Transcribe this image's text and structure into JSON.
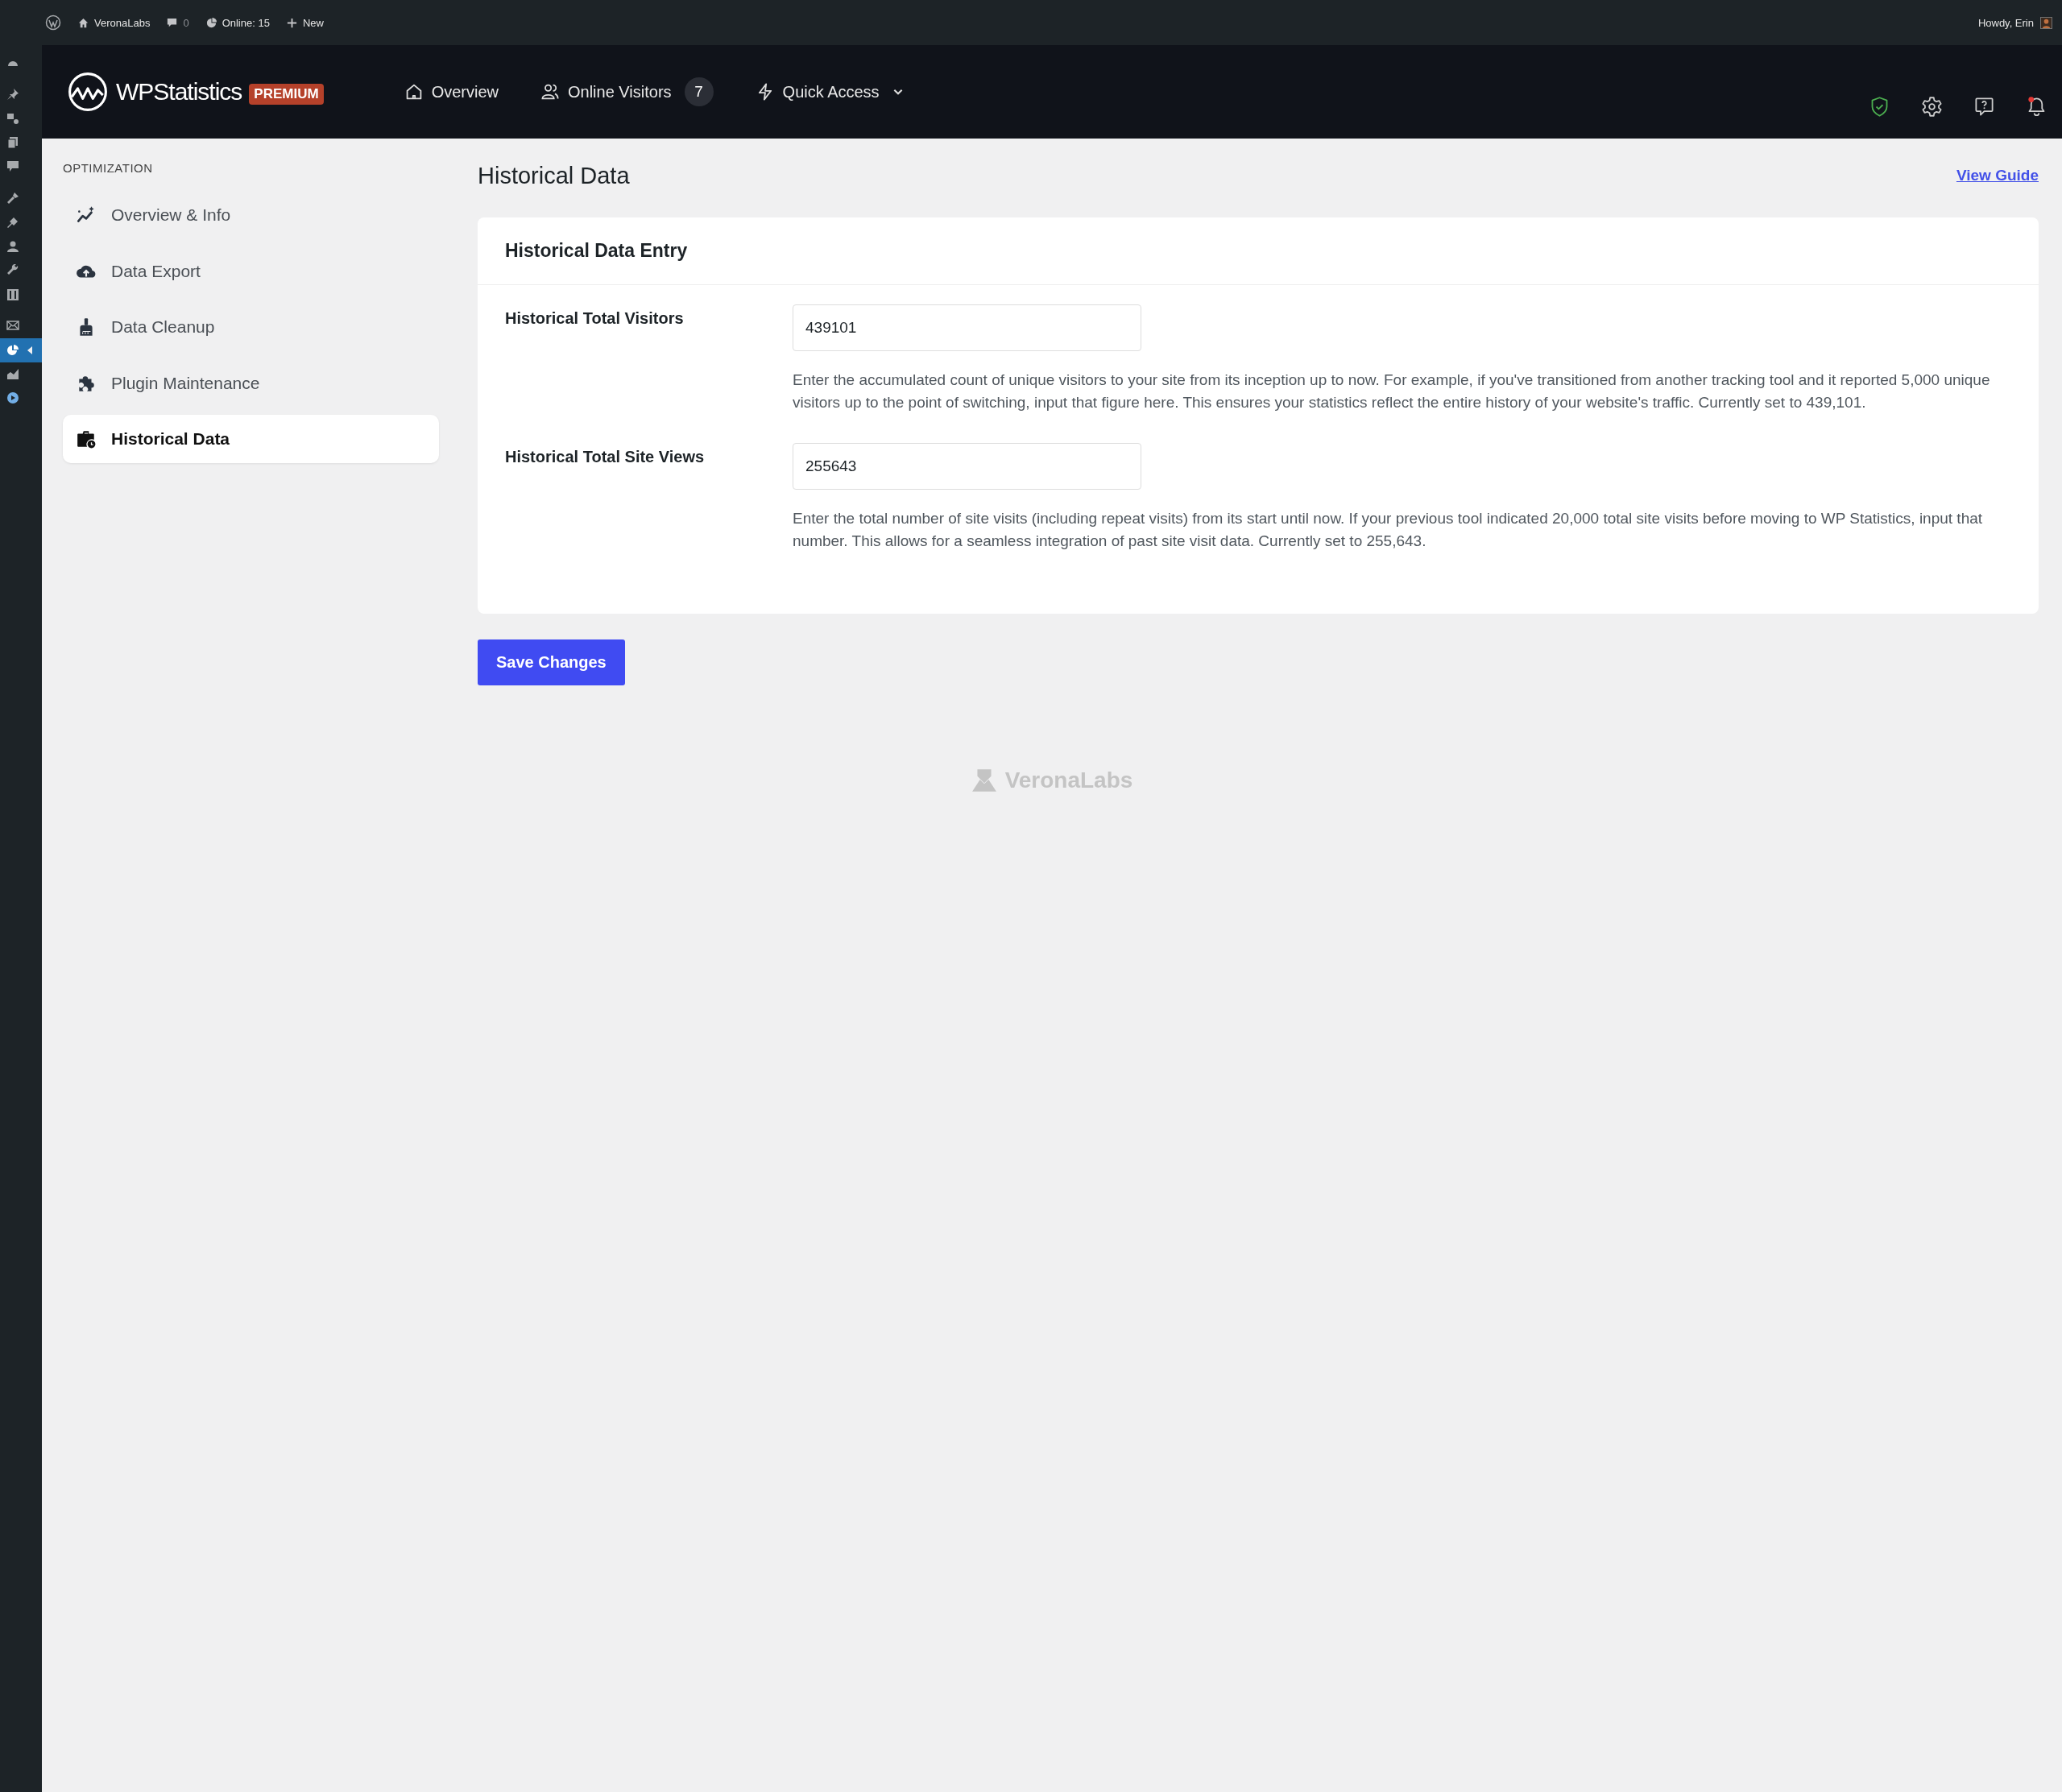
{
  "admin_bar": {
    "site_name": "VeronaLabs",
    "comments_count": "0",
    "online": "Online: 15",
    "new": "New",
    "greeting": "Howdy, Erin"
  },
  "admin_menu": [
    {
      "selected": false
    },
    {
      "selected": false
    },
    {
      "selected": false
    },
    {
      "selected": false
    },
    {
      "selected": false
    },
    {
      "selected": false
    },
    {
      "selected": false
    },
    {
      "selected": false
    },
    {
      "selected": false
    },
    {
      "selected": false
    },
    {
      "selected": false
    },
    {
      "selected": true
    },
    {
      "selected": false
    },
    {
      "selected": false
    }
  ],
  "header": {
    "brand": "WPStatistics",
    "badge": "PREMIUM",
    "notifications_unread": true,
    "nav": [
      {
        "label": "Overview"
      },
      {
        "label": "Online Visitors",
        "count": "7"
      },
      {
        "label": "Quick Access",
        "dropdown": true
      }
    ]
  },
  "sidebar": {
    "section": "OPTIMIZATION",
    "items": [
      {
        "label": "Overview & Info",
        "selected": false
      },
      {
        "label": "Data Export",
        "selected": false
      },
      {
        "label": "Data Cleanup",
        "selected": false
      },
      {
        "label": "Plugin Maintenance",
        "selected": false
      },
      {
        "label": "Historical Data",
        "selected": true
      }
    ]
  },
  "page": {
    "title": "Historical Data",
    "guide_link": "View Guide"
  },
  "card": {
    "title": "Historical Data Entry",
    "fields": [
      {
        "label": "Historical Total Visitors",
        "value": "439101",
        "help": "Enter the accumulated count of unique visitors to your site from its inception up to now. For example, if you've transitioned from another tracking tool and it reported 5,000 unique visitors up to the point of switching, input that figure here. This ensures your statistics reflect the entire history of your website's traffic. Currently set to 439,101."
      },
      {
        "label": "Historical Total Site Views",
        "value": "255643",
        "help": "Enter the total number of site visits (including repeat visits) from its start until now. If your previous tool indicated 20,000 total site visits before moving to WP Statistics, input that number. This allows for a seamless integration of past site visit data. Currently set to 255,643."
      }
    ]
  },
  "save_button": "Save Changes",
  "footer": {
    "brand": "VeronaLabs"
  }
}
